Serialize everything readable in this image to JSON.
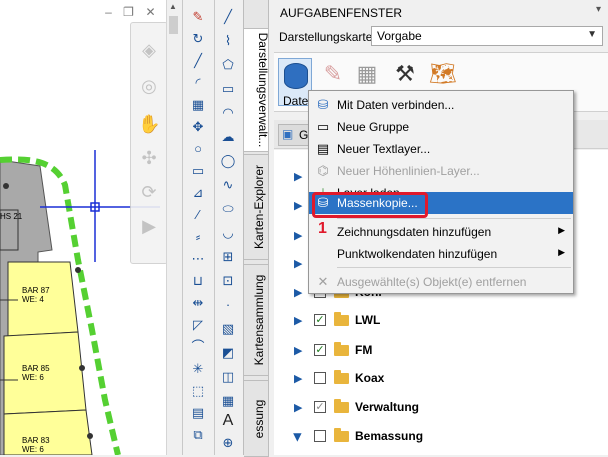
{
  "drawing": {
    "labels": [
      "HS 21",
      "BAR 87\nWE: 4",
      "BAR 85\nWE: 6",
      "BAR 83\nWE: 6"
    ],
    "colors": {
      "parcel": "#ffff99",
      "boundary": "#55d032",
      "crosshair": "#1a2fd6",
      "building": "#a9a9a9"
    }
  },
  "window_controls": {
    "min": "–",
    "restore": "❐",
    "close": "✕"
  },
  "vertical_tabs": [
    "Darstellungsverwalt...",
    "Karten-Explorer",
    "Kartensammlung",
    "essung"
  ],
  "task_pane": {
    "title": "AUFGABENFENSTER",
    "map_label": "Darstellungskarte:",
    "map_value": "Vorgabe",
    "daten_label": "Daten",
    "tab_label": "G"
  },
  "menu": {
    "items": [
      {
        "label": "Mit Daten verbinden...",
        "icon": "database-connect-icon",
        "disabled": false,
        "submenu": false
      },
      {
        "label": "Neue Gruppe",
        "icon": "new-group-icon",
        "disabled": false,
        "submenu": false
      },
      {
        "label": "Neuer Textlayer...",
        "icon": "text-layer-icon",
        "disabled": false,
        "submenu": false
      },
      {
        "label": "Neuer Höhenlinien-Layer...",
        "icon": "contour-layer-icon",
        "disabled": true,
        "submenu": false
      },
      {
        "label": "Layer laden...",
        "icon": "load-layer-icon",
        "disabled": false,
        "submenu": false
      },
      {
        "label": "Massenkopie...",
        "icon": "bulk-copy-icon",
        "disabled": false,
        "submenu": false,
        "highlighted": true
      },
      {
        "label": "Zeichnungsdaten hinzufügen",
        "icon": "",
        "disabled": false,
        "submenu": true
      },
      {
        "label": "Punktwolkendaten hinzufügen",
        "icon": "",
        "disabled": false,
        "submenu": true
      },
      {
        "label": "Ausgewählte(s) Objekt(e) entfernen",
        "icon": "remove-icon",
        "disabled": true,
        "submenu": false
      }
    ],
    "step_number": "1",
    "highlight_color": "#e0192b"
  },
  "tree": {
    "rows": [
      {
        "label": "Koni",
        "checked": true
      },
      {
        "label": "LWL",
        "checked": true
      },
      {
        "label": "FM",
        "checked": true
      },
      {
        "label": "Koax",
        "checked": false
      },
      {
        "label": "Verwaltung",
        "checked": true
      },
      {
        "label": "Bemassung",
        "checked": false
      }
    ]
  }
}
